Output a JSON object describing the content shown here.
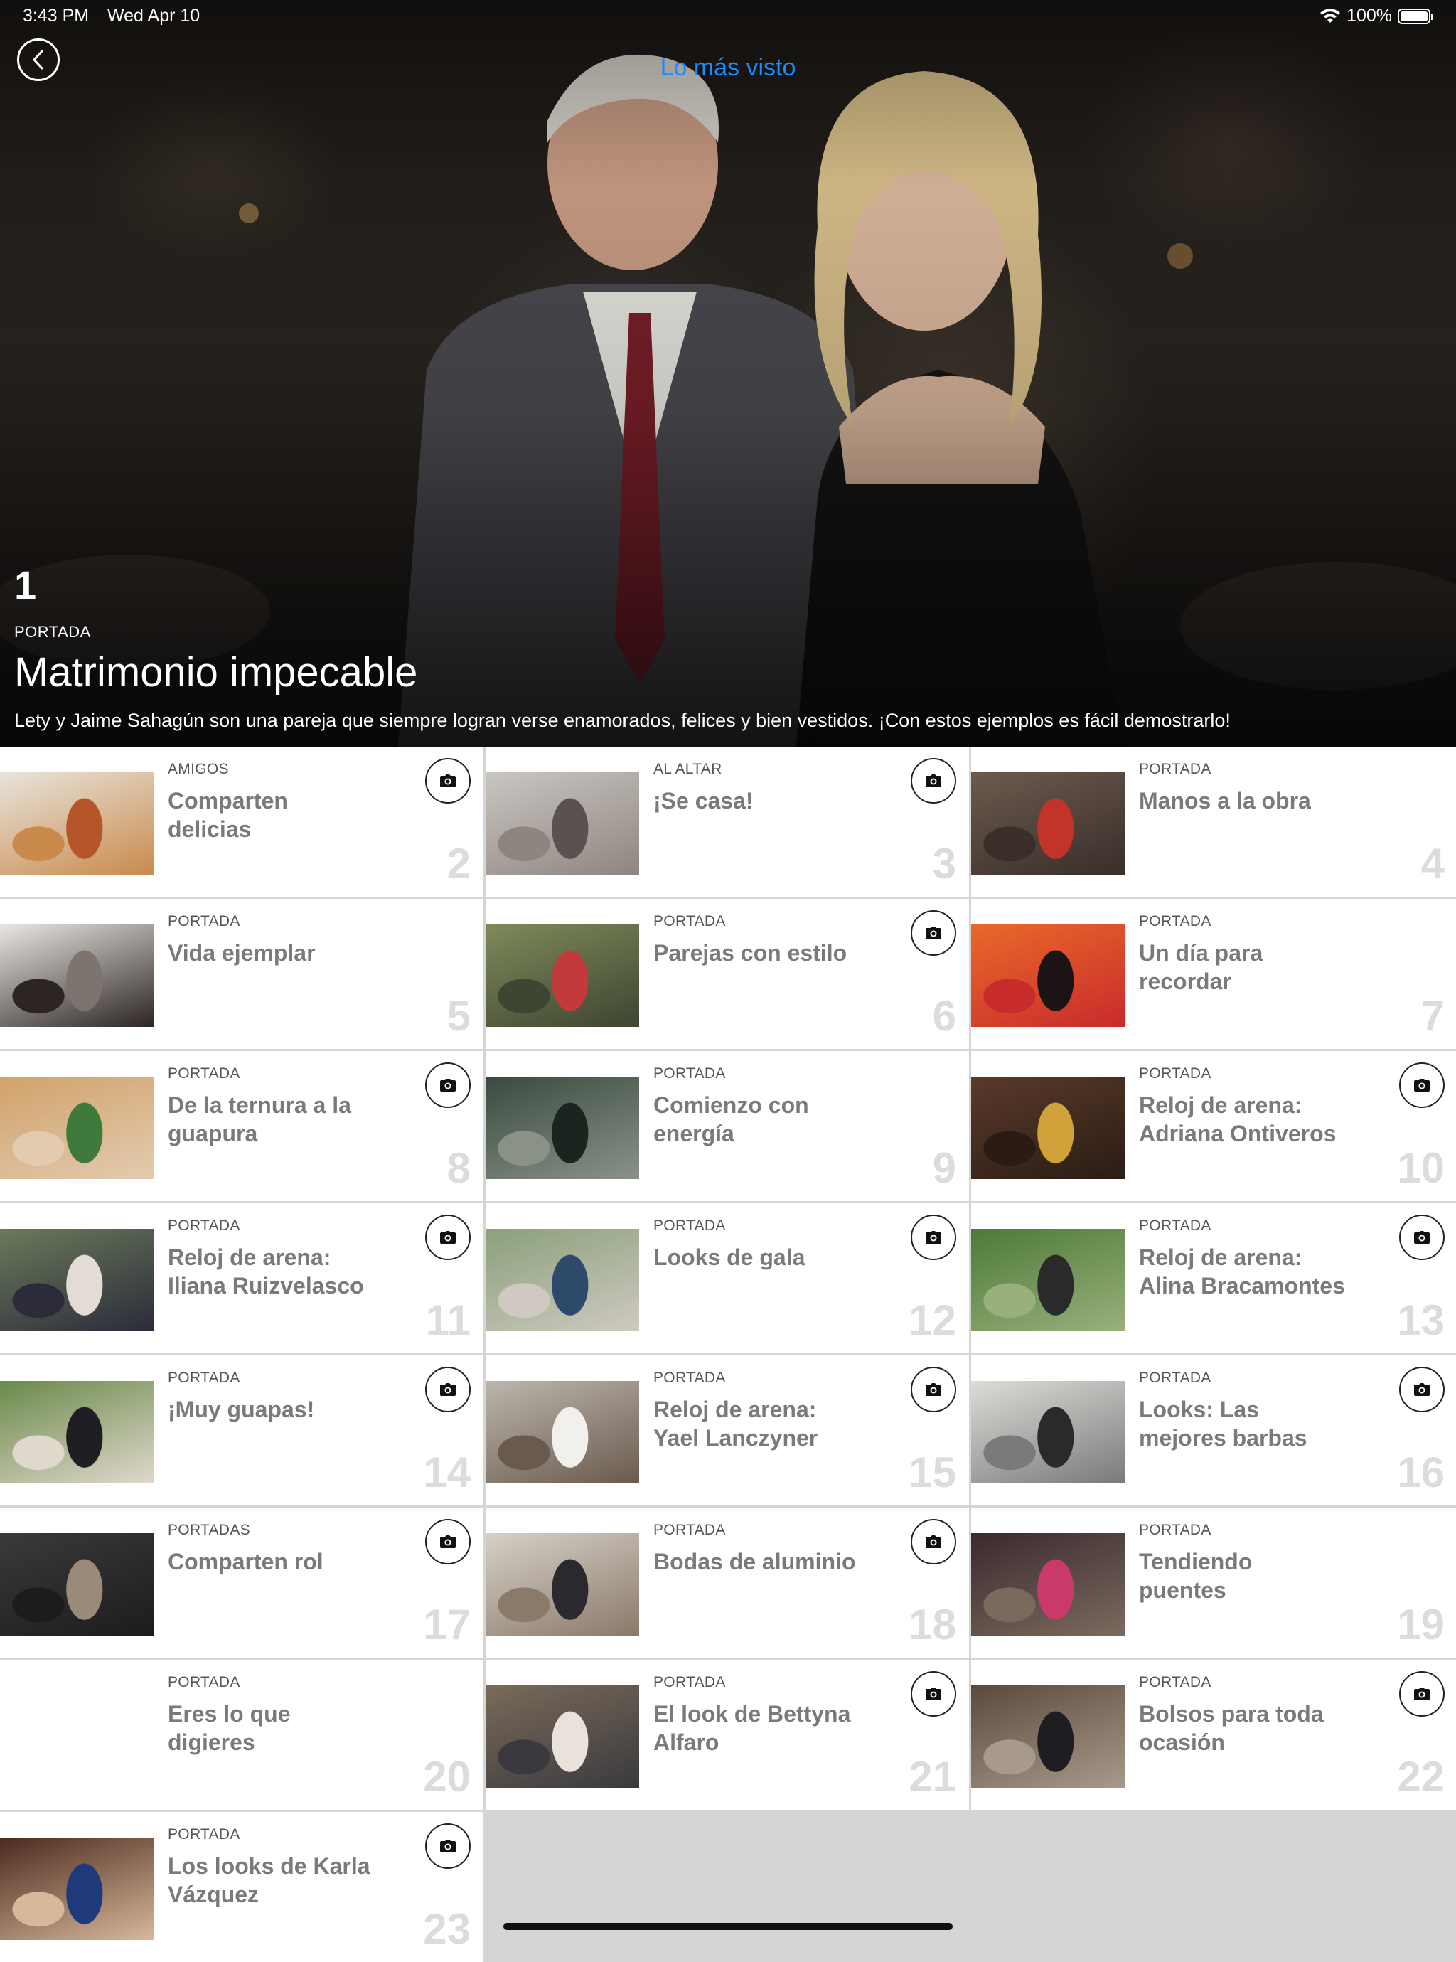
{
  "status_bar": {
    "time": "3:43 PM",
    "date": "Wed Apr 10",
    "battery_text": "100%",
    "battery_level": 1.0
  },
  "nav": {
    "title": "Lo más visto",
    "back_icon": "chevron-left-icon"
  },
  "featured": {
    "rank": "1",
    "category": "PORTADA",
    "title": "Matrimonio impecable",
    "description": "Lety y Jaime Sahagún son una pareja que siempre logran verse enamorados, felices y bien vestidos. ¡Con estos ejemplos es fácil demostrarlo!"
  },
  "articles": [
    {
      "rank": "2",
      "category": "AMIGOS",
      "title": "Comparten delicias",
      "has_gallery": true,
      "thumb": [
        "#e8e4dc",
        "#b5552a",
        "#c98a4c"
      ]
    },
    {
      "rank": "3",
      "category": "AL ALTAR",
      "title": "¡Se casa!",
      "has_gallery": true,
      "thumb": [
        "#c9c6c2",
        "#5a5250",
        "#8f8580"
      ]
    },
    {
      "rank": "4",
      "category": "PORTADA",
      "title": "Manos a la obra",
      "has_gallery": false,
      "thumb": [
        "#6b5a4e",
        "#c2332a",
        "#3a2e2a"
      ]
    },
    {
      "rank": "5",
      "category": "PORTADA",
      "title": "Vida ejemplar",
      "has_gallery": false,
      "thumb": [
        "#e9e7e2",
        "#7d7470",
        "#2c2523"
      ]
    },
    {
      "rank": "6",
      "category": "PORTADA",
      "title": "Parejas con estilo",
      "has_gallery": true,
      "thumb": [
        "#7f8a5a",
        "#c23a3a",
        "#3e4531"
      ]
    },
    {
      "rank": "7",
      "category": "PORTADA",
      "title": "Un día para recordar",
      "has_gallery": false,
      "thumb": [
        "#e9692a",
        "#1c1414",
        "#c82b2b"
      ]
    },
    {
      "rank": "8",
      "category": "PORTADA",
      "title": "De la ternura a la guapura",
      "has_gallery": true,
      "thumb": [
        "#d1a26a",
        "#3f7a3c",
        "#e3cbb0"
      ]
    },
    {
      "rank": "9",
      "category": "PORTADA",
      "title": "Comienzo con energía",
      "has_gallery": false,
      "thumb": [
        "#3a4a40",
        "#1c2420",
        "#8a9288"
      ]
    },
    {
      "rank": "10",
      "category": "PORTADA",
      "title": "Reloj de arena: Adriana Ontiveros",
      "has_gallery": true,
      "thumb": [
        "#5a3a2a",
        "#d2a23a",
        "#2a1c14"
      ]
    },
    {
      "rank": "11",
      "category": "PORTADA",
      "title": "Reloj de arena: Iliana Ruizvelasco",
      "has_gallery": true,
      "thumb": [
        "#6a7a5a",
        "#e3dcd4",
        "#2b2b3a"
      ]
    },
    {
      "rank": "12",
      "category": "PORTADA",
      "title": "Looks de gala",
      "has_gallery": true,
      "thumb": [
        "#8aa07a",
        "#2e4a6a",
        "#cfc9c2"
      ]
    },
    {
      "rank": "13",
      "category": "PORTADA",
      "title": "Reloj de arena: Alina Bracamontes",
      "has_gallery": true,
      "thumb": [
        "#4c7a3a",
        "#2a2a2a",
        "#9ab07a"
      ]
    },
    {
      "rank": "14",
      "category": "PORTADA",
      "title": "¡Muy guapas!",
      "has_gallery": true,
      "thumb": [
        "#6a8a4a",
        "#1e1e24",
        "#e0d8cc"
      ]
    },
    {
      "rank": "15",
      "category": "PORTADA",
      "title": "Reloj de arena: Yael Lanczyner",
      "has_gallery": true,
      "thumb": [
        "#bcb6ae",
        "#f2f0ec",
        "#6a5a4e"
      ]
    },
    {
      "rank": "16",
      "category": "PORTADA",
      "title": "Looks: Las mejores barbas",
      "has_gallery": true,
      "thumb": [
        "#dcdcd8",
        "#2a2a2c",
        "#7a7a7a"
      ]
    },
    {
      "rank": "17",
      "category": "PORTADAS",
      "title": "Comparten rol",
      "has_gallery": true,
      "thumb": [
        "#3a3a3a",
        "#9a8a7a",
        "#1c1c1c"
      ]
    },
    {
      "rank": "18",
      "category": "PORTADA",
      "title": "Bodas de aluminio",
      "has_gallery": true,
      "thumb": [
        "#d6d0c8",
        "#2a2a2e",
        "#8a7a6a"
      ]
    },
    {
      "rank": "19",
      "category": "PORTADA",
      "title": "Tendiendo puentes",
      "has_gallery": false,
      "thumb": [
        "#3a2a2e",
        "#c83a6a",
        "#7a6a5e"
      ]
    },
    {
      "rank": "20",
      "category": "PORTADA",
      "title": "Eres lo que digieres",
      "has_gallery": false,
      "thumb": null
    },
    {
      "rank": "21",
      "category": "PORTADA",
      "title": "El look de Bettyna Alfaro",
      "has_gallery": true,
      "thumb": [
        "#7a6a5a",
        "#e8e2da",
        "#3a3a3e"
      ]
    },
    {
      "rank": "22",
      "category": "PORTADA",
      "title": "Bolsos para toda ocasión",
      "has_gallery": true,
      "thumb": [
        "#5a4a3e",
        "#1e1e22",
        "#a89a8a"
      ]
    },
    {
      "rank": "23",
      "category": "PORTADA",
      "title": "Los looks de Karla Vázquez",
      "has_gallery": true,
      "thumb": [
        "#4a2a1e",
        "#1e3a7a",
        "#d8b89a"
      ]
    }
  ]
}
